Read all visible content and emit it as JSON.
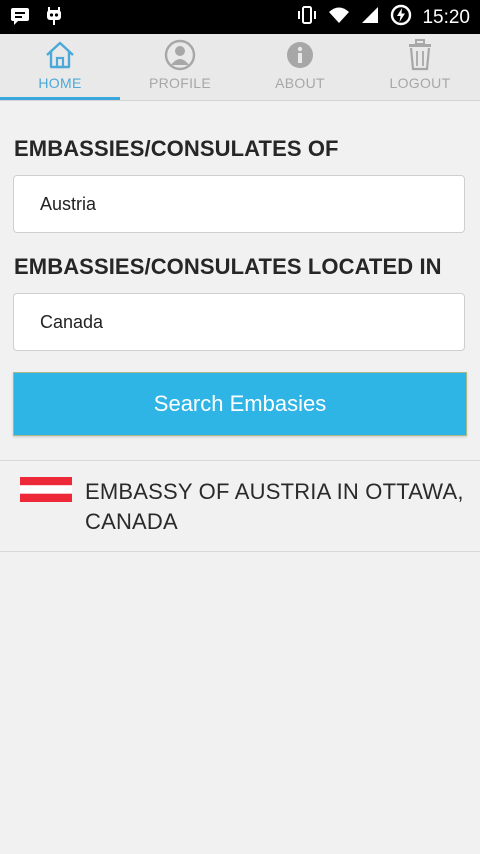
{
  "status_bar": {
    "time": "15:20"
  },
  "tabs": [
    {
      "label": "HOME",
      "icon": "home-icon",
      "active": true
    },
    {
      "label": "PROFILE",
      "icon": "profile-icon",
      "active": false
    },
    {
      "label": "ABOUT",
      "icon": "info-icon",
      "active": false
    },
    {
      "label": "LOGOUT",
      "icon": "trash-icon",
      "active": false
    }
  ],
  "form": {
    "of_label": "EMBASSIES/CONSULATES OF",
    "of_value": "Austria",
    "located_label": "EMBASSIES/CONSULATES LOCATED IN",
    "located_value": "Canada",
    "search_button": "Search Embasies"
  },
  "results": [
    {
      "title": "EMBASSY OF AUSTRIA IN OTTAWA, CANADA",
      "flag": "austria-flag"
    }
  ],
  "colors": {
    "accent": "#2fb4e6",
    "tab_active": "#4aa9d8",
    "flag_red": "#ed2939"
  }
}
